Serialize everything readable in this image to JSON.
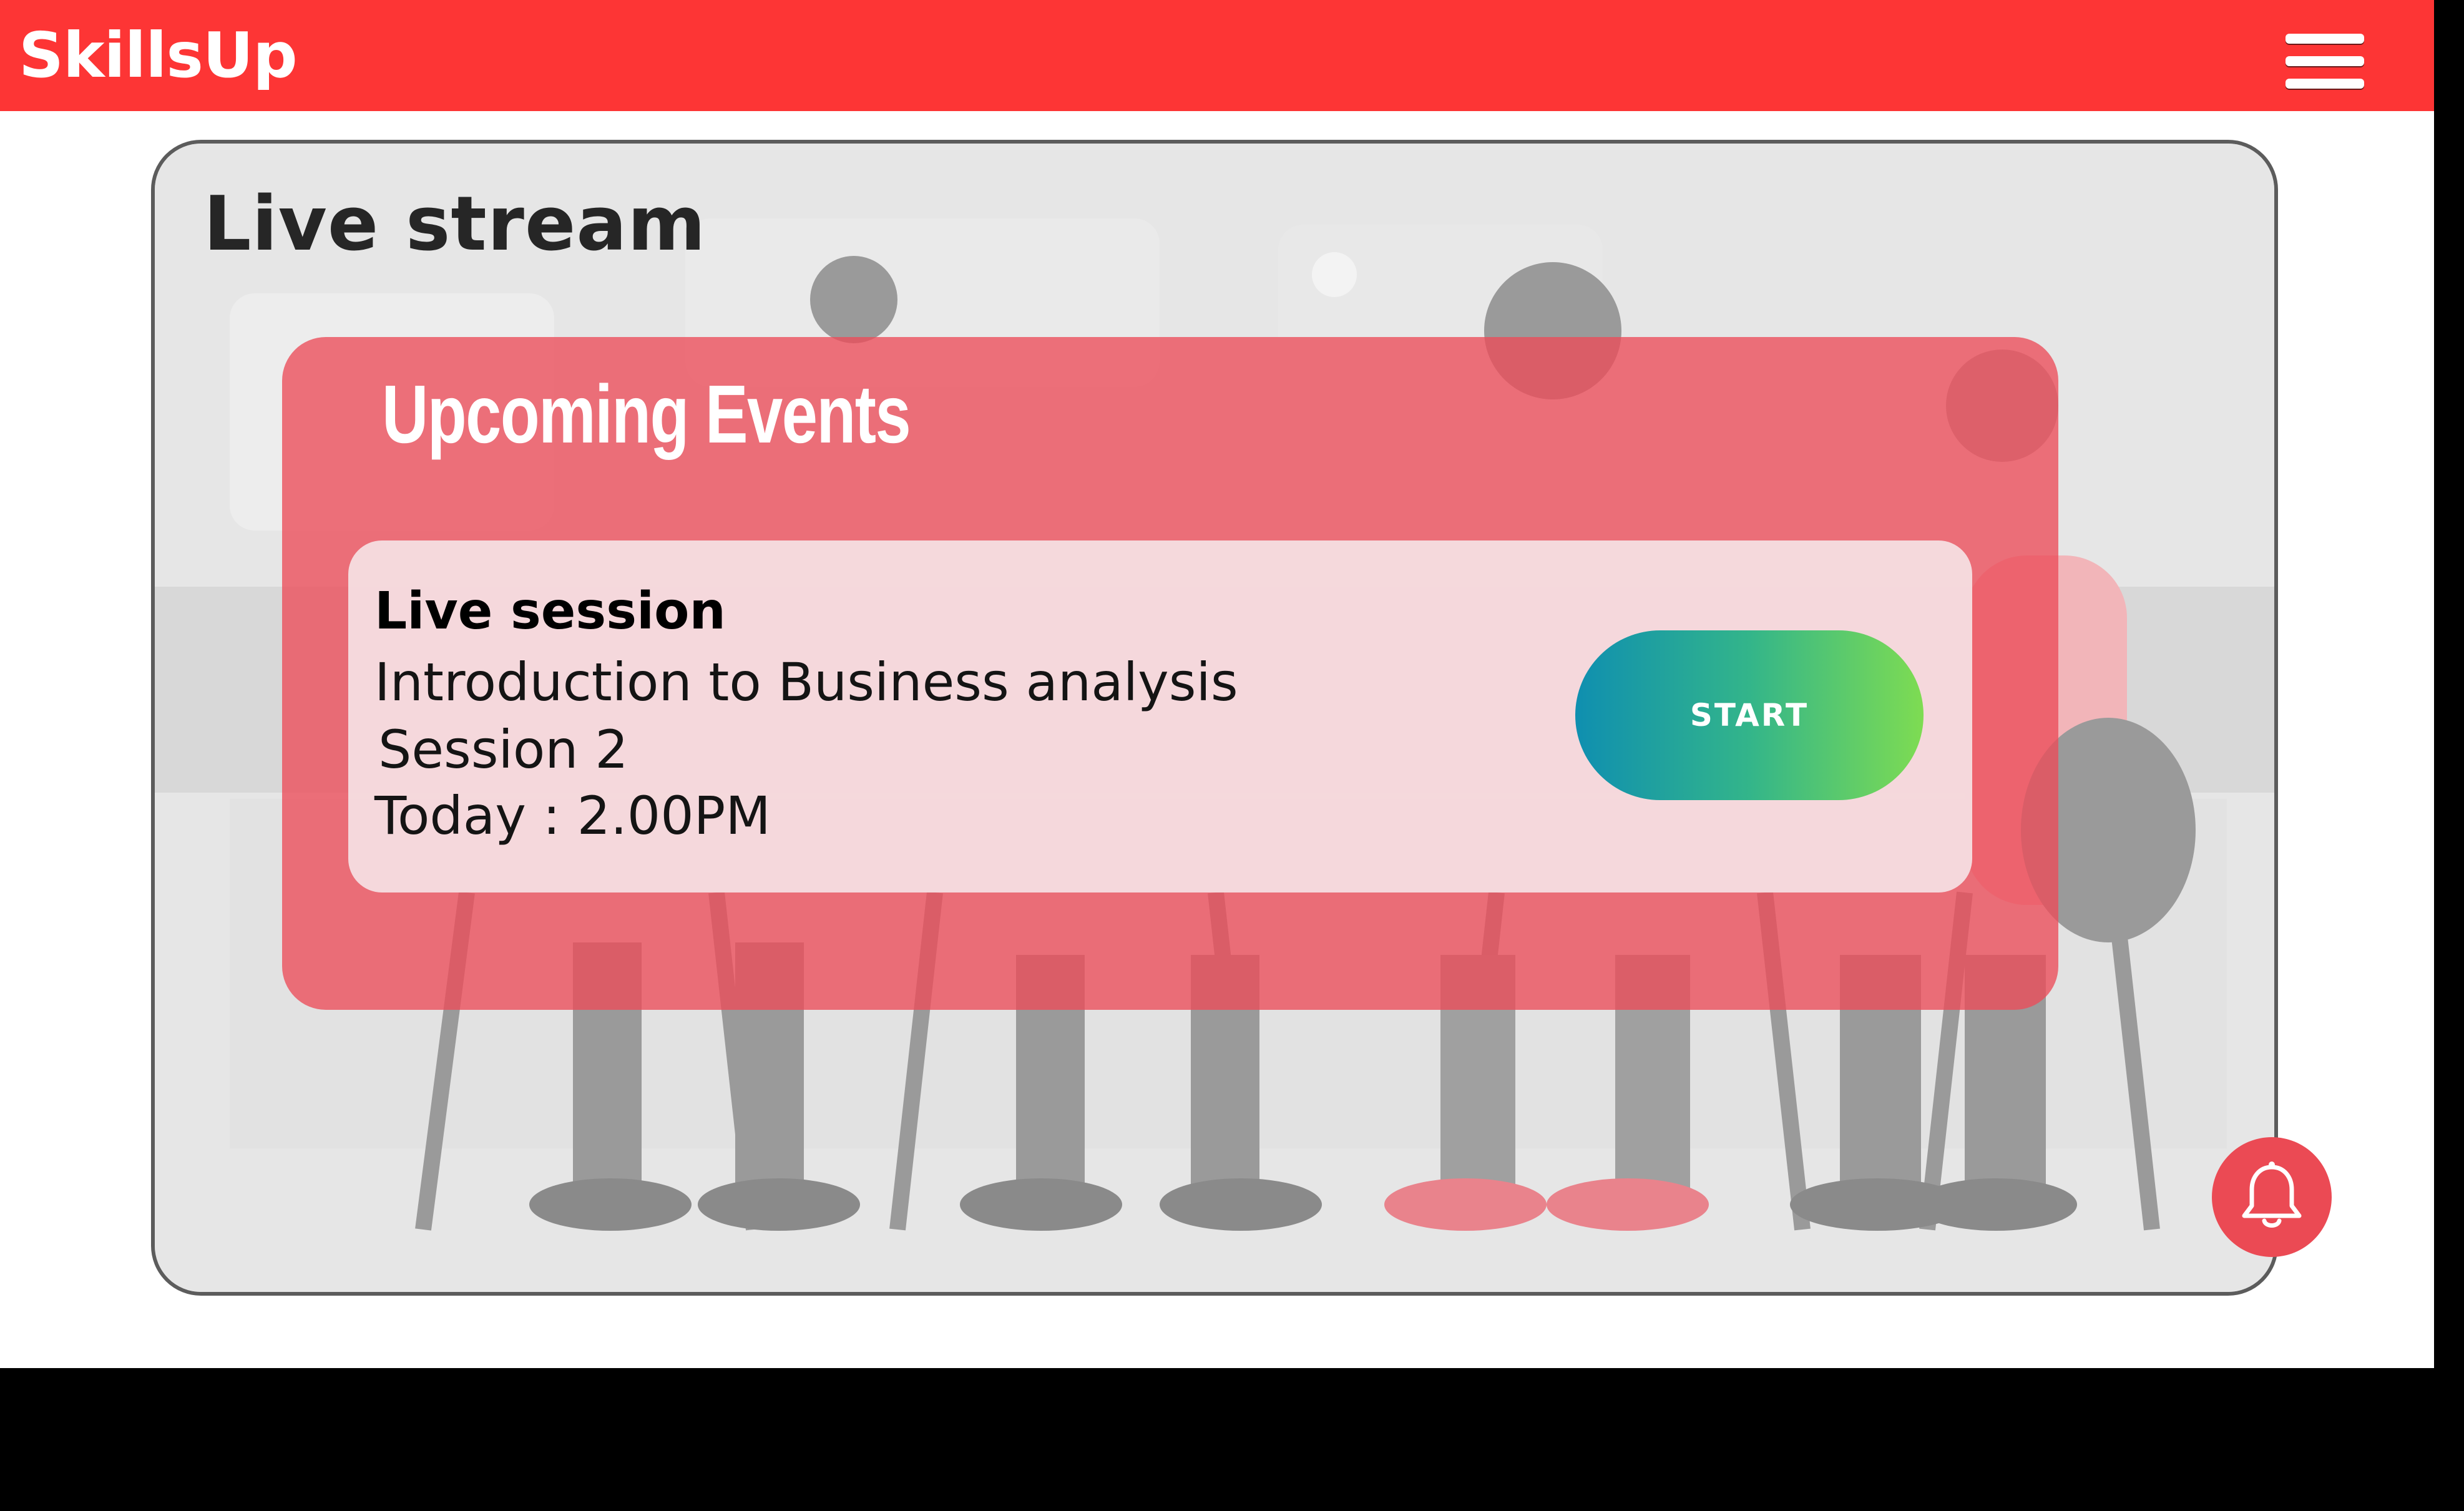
{
  "header": {
    "brand": "SkillsUp",
    "menu_icon": "hamburger-menu-icon"
  },
  "live_stream": {
    "title": "Live stream"
  },
  "upcoming_events": {
    "title": "Upcoming Events",
    "session": {
      "type": "Live session",
      "course": "Introduction to Business analysis",
      "session_number": "Session 2",
      "time": "Today : 2.00PM",
      "start_label": "START"
    }
  },
  "notifications": {
    "icon": "bell-icon"
  },
  "colors": {
    "brand_red": "#fd3535",
    "panel_red": "#ec4c58",
    "start_gradient_from": "#0f8fb0",
    "start_gradient_to": "#7edc52",
    "bell_bg": "#eb4a54"
  }
}
